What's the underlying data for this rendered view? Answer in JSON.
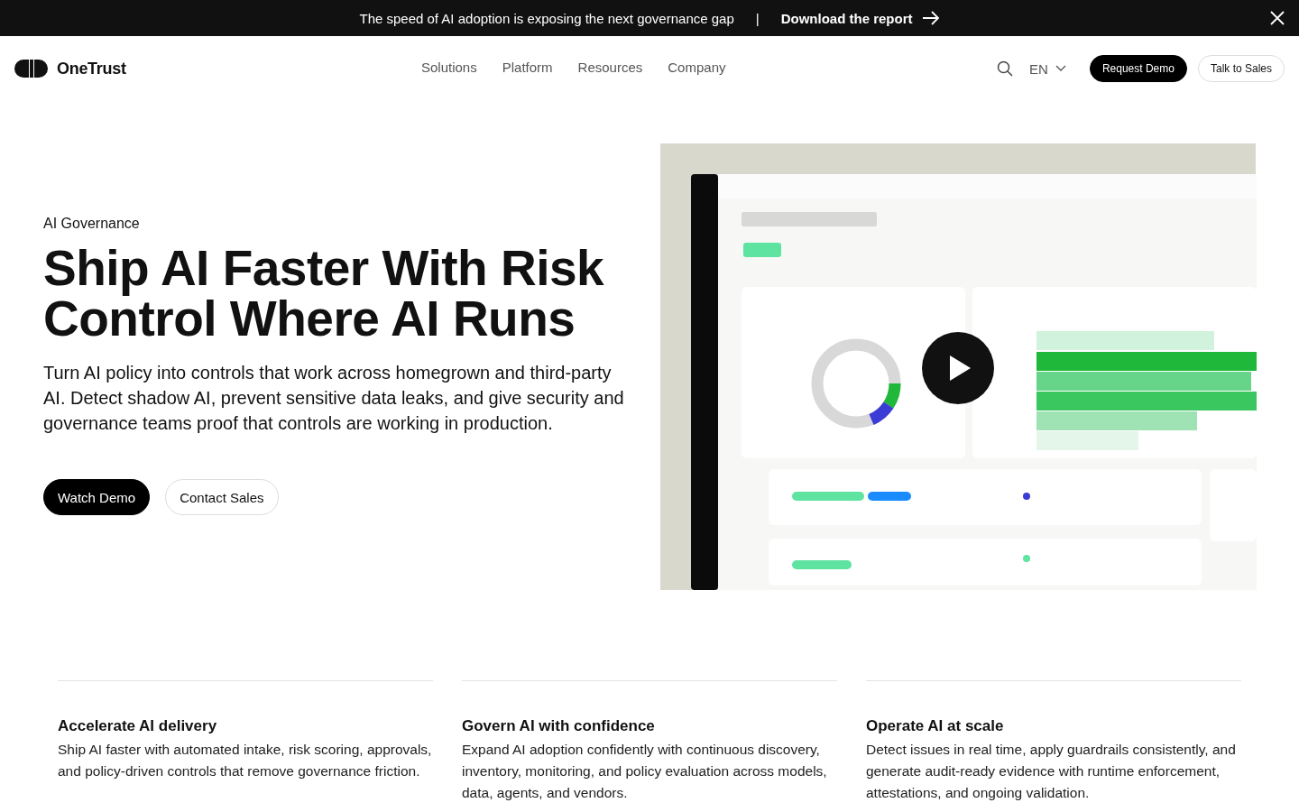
{
  "banner": {
    "message": "The speed of AI adoption is exposing the next governance gap",
    "separator": "|",
    "link": "Download the report"
  },
  "nav": {
    "brand": "OneTrust",
    "links": [
      "Solutions",
      "Platform",
      "Resources",
      "Company"
    ],
    "language": "EN",
    "primary_button": "Request Demo",
    "secondary_button": "Talk to Sales"
  },
  "hero": {
    "eyebrow": "AI Governance",
    "title": "Ship AI Faster With Risk Control Where AI Runs",
    "description": "Turn AI policy into controls that work across homegrown and third-party AI. Detect shadow AI, prevent sensitive data leaks, and give security and governance teams proof that controls are working in production.",
    "buttons": [
      {
        "label": "Watch Demo",
        "kind": "primary"
      },
      {
        "label": "Contact Sales",
        "kind": "secondary"
      }
    ]
  },
  "features": [
    {
      "title": "Accelerate AI delivery",
      "text": "Ship AI faster with automated intake, risk scoring, approvals, and policy-driven controls that remove governance friction."
    },
    {
      "title": "Govern AI with confidence",
      "text": "Expand AI adoption confidently with continuous discovery, inventory, monitoring, and policy evaluation across models, data, agents, and vendors."
    },
    {
      "title": "Operate AI at scale",
      "text": "Detect issues in real time, apply guardrails consistently, and generate audit-ready evidence with runtime enforcement, attestations, and ongoing validation."
    }
  ]
}
